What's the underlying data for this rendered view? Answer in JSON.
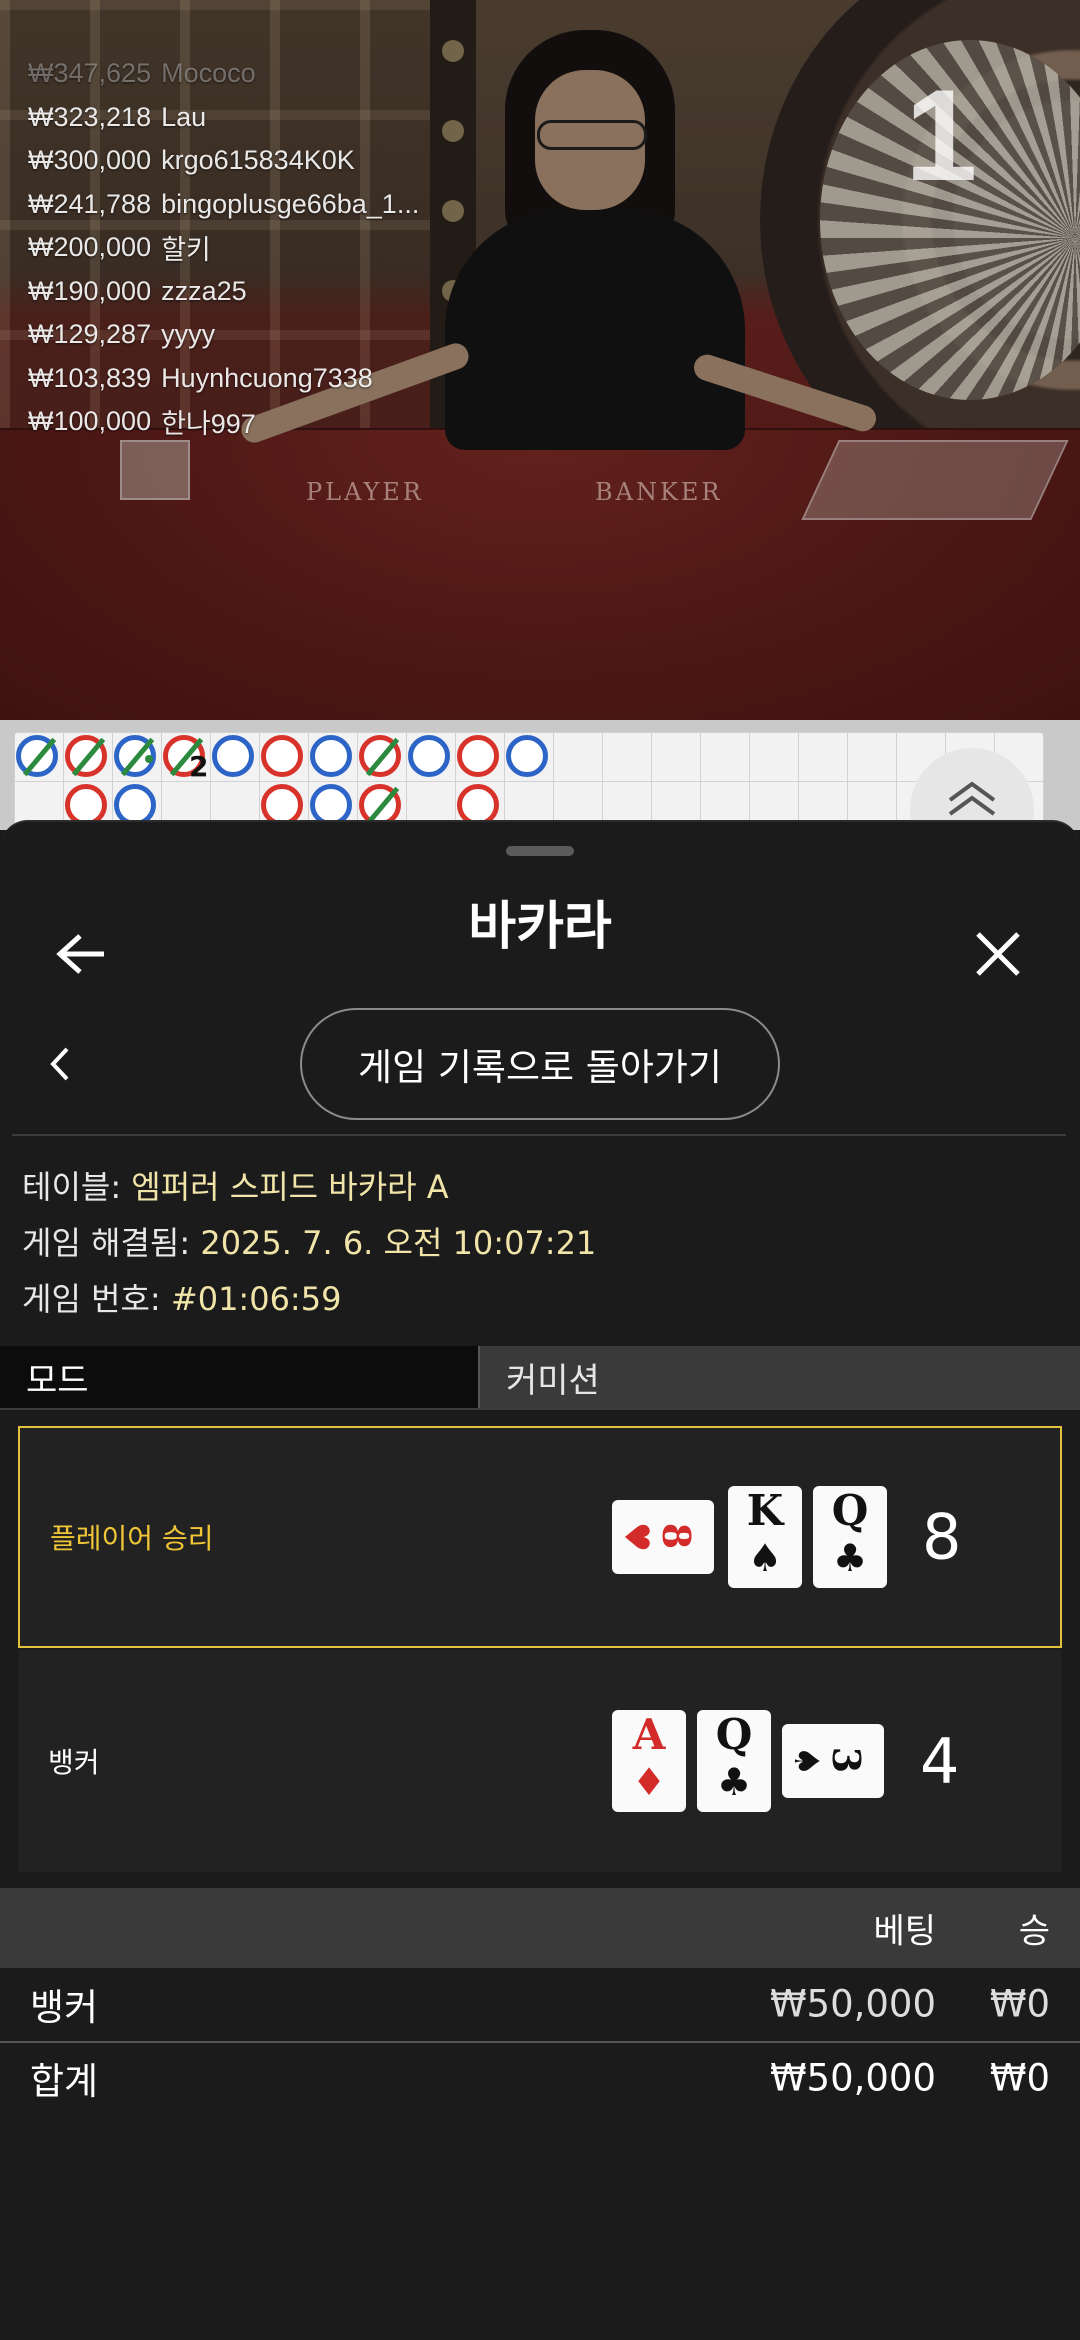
{
  "video": {
    "round_counter": "1",
    "felt_labels": {
      "player": "PLAYER",
      "banker": "BANKER"
    },
    "leaderboard": [
      {
        "amount": "₩347,625",
        "name": "Mococo"
      },
      {
        "amount": "₩323,218",
        "name": "Lau"
      },
      {
        "amount": "₩300,000",
        "name": "krgo615834K0K"
      },
      {
        "amount": "₩241,788",
        "name": "bingoplusge66ba_1..."
      },
      {
        "amount": "₩200,000",
        "name": "할키"
      },
      {
        "amount": "₩190,000",
        "name": "zzza25"
      },
      {
        "amount": "₩129,287",
        "name": "yyyy"
      },
      {
        "amount": "₩103,839",
        "name": "Huynhcuong7338"
      },
      {
        "amount": "₩100,000",
        "name": "한나997"
      }
    ]
  },
  "roadmap": {
    "bead_label": "2",
    "up_icon": "double-chevron-up-icon"
  },
  "sheet": {
    "title": "바카라",
    "back_icon": "arrow-left-icon",
    "close_icon": "close-icon",
    "prev_icon": "chevron-left-icon",
    "back_to_history": "게임 기록으로 돌아가기",
    "info": {
      "table_label": "테이블:",
      "table_value": "엠퍼러 스피드 바카라 A",
      "resolved_label": "게임 해결됨:",
      "resolved_value": "2025. 7. 6. 오전 10:07:21",
      "game_no_label": "게임 번호:",
      "game_no_value": "#01:06:59"
    },
    "tabs": {
      "mode": "모드",
      "commission": "커미션"
    },
    "hands": [
      {
        "label": "플레이어 승리",
        "score": "8",
        "winner": true,
        "cards": [
          {
            "rank": "8",
            "suit": "♥",
            "color": "#d32a2a",
            "orientation": "sideways"
          },
          {
            "rank": "K",
            "suit": "♠",
            "color": "#111111",
            "orientation": "upright"
          },
          {
            "rank": "Q",
            "suit": "♣",
            "color": "#111111",
            "orientation": "upright"
          }
        ]
      },
      {
        "label": "뱅커",
        "score": "4",
        "winner": false,
        "cards": [
          {
            "rank": "A",
            "suit": "♦",
            "color": "#d32a2a",
            "orientation": "upright"
          },
          {
            "rank": "Q",
            "suit": "♣",
            "color": "#111111",
            "orientation": "upright"
          },
          {
            "rank": "3",
            "suit": "♠",
            "color": "#111111",
            "orientation": "sideways"
          }
        ]
      }
    ],
    "bets": {
      "col_bet": "베팅",
      "col_win": "승",
      "rows": [
        {
          "label": "뱅커",
          "bet": "₩50,000",
          "win": "₩0"
        }
      ],
      "total": {
        "label": "합계",
        "bet": "₩50,000",
        "win": "₩0"
      }
    }
  },
  "colors": {
    "win_border": "#e2c23a",
    "win_text": "#f0c637",
    "info_value": "#f1e4a8",
    "player_bead": "#2d64c8",
    "banker_bead": "#d8332b",
    "tie_mark": "#2b8a3e"
  }
}
